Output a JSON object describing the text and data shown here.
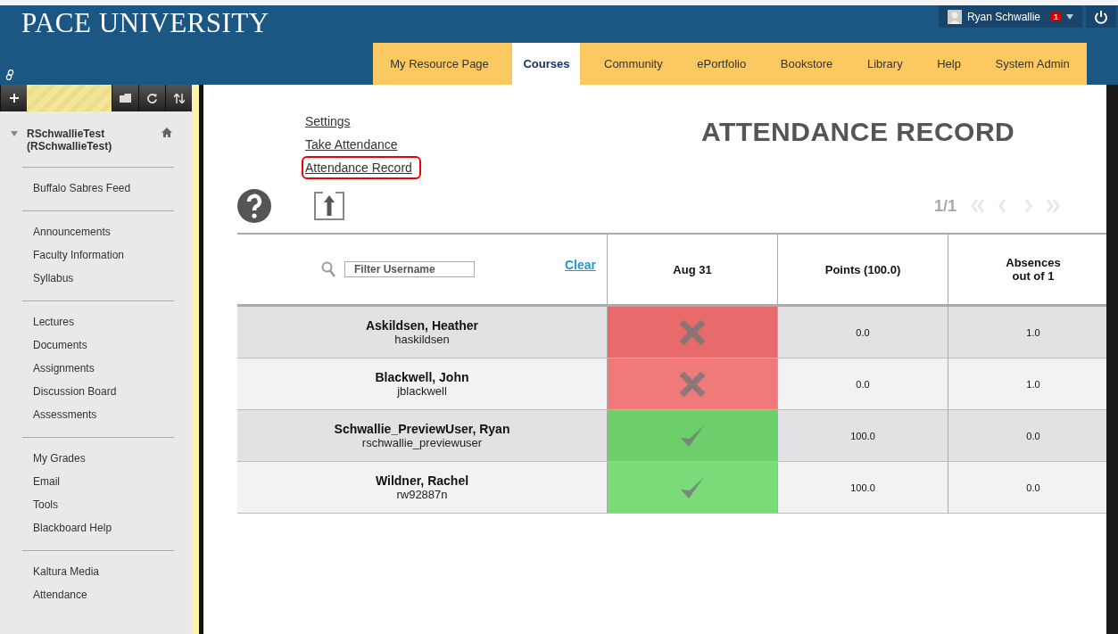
{
  "header": {
    "logo": "PACE UNIVERSITY",
    "user": {
      "name": "Ryan Schwallie",
      "notifications": "1"
    }
  },
  "tabs": [
    {
      "label": "My Resource Page",
      "selected": false
    },
    {
      "label": "Courses",
      "selected": true
    },
    {
      "label": "Community",
      "selected": false
    },
    {
      "label": "ePortfolio",
      "selected": false
    },
    {
      "label": "Bookstore",
      "selected": false
    },
    {
      "label": "Library",
      "selected": false
    },
    {
      "label": "Help",
      "selected": false
    },
    {
      "label": "System Admin",
      "selected": false
    }
  ],
  "sidebar": {
    "course": {
      "title": "RSchwallieTest",
      "subtitle": "(RSchwallieTest)",
      "expanded": true
    },
    "groups": [
      [
        "Buffalo Sabres Feed"
      ],
      [
        "Announcements",
        "Faculty Information",
        "Syllabus"
      ],
      [
        "Lectures",
        "Documents",
        "Assignments",
        "Discussion Board",
        "Assessments"
      ],
      [
        "My Grades",
        "Email",
        "Tools",
        "Blackboard Help"
      ],
      [
        "Kaltura Media",
        "Attendance"
      ]
    ]
  },
  "links": [
    {
      "label": "Settings",
      "highlighted": false
    },
    {
      "label": "Take Attendance",
      "highlighted": false
    },
    {
      "label": "Attendance Record",
      "highlighted": true
    }
  ],
  "page_title": "ATTENDANCE RECORD",
  "pager": {
    "text": "1/1",
    "disabled": true
  },
  "table": {
    "filter": {
      "placeholder": "Filter Username"
    },
    "clear": "Clear",
    "columns": [
      "Aug 31",
      "Points (100.0)",
      "Absences\nout of 1"
    ],
    "rows": [
      {
        "name": "Askildsen, Heather",
        "username": "haskildsen",
        "kind": "absent",
        "points": "0.0",
        "absences": "1.0"
      },
      {
        "name": "Blackwell, John",
        "username": "jblackwell",
        "kind": "absent",
        "points": "0.0",
        "absences": "1.0"
      },
      {
        "name": "Schwallie_PreviewUser, Ryan",
        "username": "rschwallie_previewuser",
        "kind": "present",
        "points": "100.0",
        "absences": "0.0"
      },
      {
        "name": "Wildner, Rachel",
        "username": "rw92887n",
        "kind": "present",
        "points": "100.0",
        "absences": "0.0"
      }
    ]
  }
}
